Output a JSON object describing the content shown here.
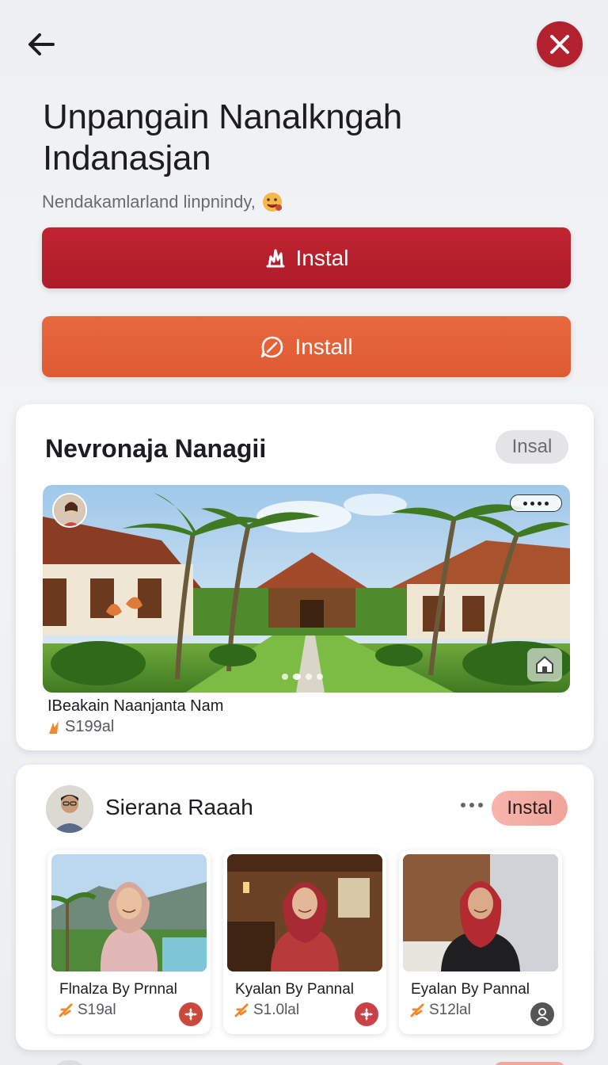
{
  "header": {
    "back_icon": "arrow-left-icon",
    "close_icon": "close-icon",
    "title": "Unpangain Nanalkngah Indanasjan",
    "subtitle": "Nendakamlarland linpnindy,",
    "subtitle_emoji": "smiling-face-emoji"
  },
  "actions": {
    "primary_label": "Instal",
    "primary_icon": "hand-wave-icon",
    "primary_color": "#b3202e",
    "secondary_label": "Install",
    "secondary_icon": "leaf-chat-icon",
    "secondary_color": "#e3603a"
  },
  "featured": {
    "title": "Nevronaja Nanagii",
    "pill_label": "Insal",
    "image_alt": "Tropical villas with palm trees",
    "more_icon": "more-dots-icon",
    "home_icon": "home-icon",
    "caption": "IBeakain Naanjanta Nam",
    "price": "S199al",
    "price_icon": "flame-icon",
    "carousel_dots": 4,
    "carousel_active": 1
  },
  "seller": {
    "name": "Sierana Raaah",
    "pill_label": "Instal",
    "more_icon": "more-dots-icon",
    "products": [
      {
        "name": "Flnalza By Prnnal",
        "price": "S19al",
        "badge_icon": "flower-icon",
        "badge_color": "#c94a3a"
      },
      {
        "name": "Kyalan By Pannal",
        "price": "S1.0lal",
        "badge_icon": "flower-icon",
        "badge_color": "#c9424a"
      },
      {
        "name": "Eyalan By Pannal",
        "price": "S12lal",
        "badge_icon": "user-circle-icon",
        "badge_color": "#555555"
      }
    ]
  },
  "colors": {
    "accent_red": "#b3202e",
    "accent_orange": "#e3603a",
    "pill_pink": "#f2a79d",
    "price_icon_orange": "#f08a2c"
  }
}
